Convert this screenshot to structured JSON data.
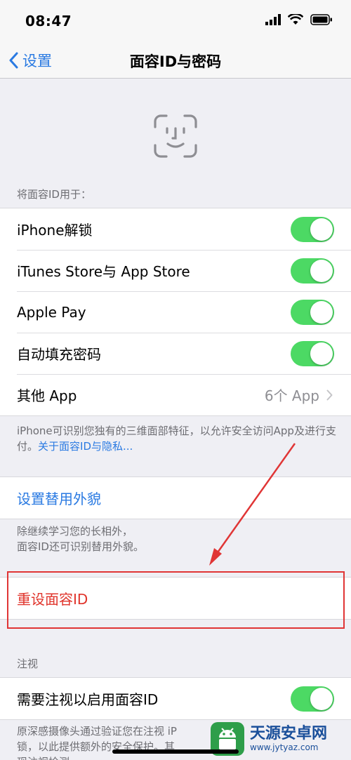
{
  "status_bar": {
    "time": "08:47"
  },
  "nav": {
    "back_label": "设置",
    "title": "面容ID与密码"
  },
  "use_for": {
    "header": "将面容ID用于：",
    "rows": [
      {
        "label": "iPhone解锁",
        "toggle_on": true
      },
      {
        "label": "iTunes Store与 App Store",
        "toggle_on": true
      },
      {
        "label": "Apple Pay",
        "toggle_on": true
      },
      {
        "label": "自动填充密码",
        "toggle_on": true
      }
    ],
    "other_apps": {
      "label": "其他 App",
      "detail": "6个 App"
    },
    "footer_text": "iPhone可识别您独有的三维面部特征，以允许安全访问App及进行支付。",
    "footer_link": "关于面容ID与隐私..."
  },
  "alternate_appearance": {
    "action_label": "设置替用外貌",
    "footer_line1": "除继续学习您的长相外，",
    "footer_line2": "面容ID还可识别替用外貌。"
  },
  "reset": {
    "label": "重设面容ID"
  },
  "attention": {
    "header": "注视",
    "row_label": "需要注视以启用面容ID",
    "toggle_on": true,
    "footer_line1": "原深感摄像头通过验证您在注视 iP",
    "footer_line2": "锁，以此提供额外的安全保护。其",
    "footer_line3": "现注视检测"
  },
  "watermark": {
    "name": "天源安卓网",
    "url": "www.jytyaz.com"
  },
  "colors": {
    "accent": "#2a7ae2",
    "toggle_on": "#4cd964",
    "danger": "#e0342b",
    "annotation": "#e03535"
  }
}
